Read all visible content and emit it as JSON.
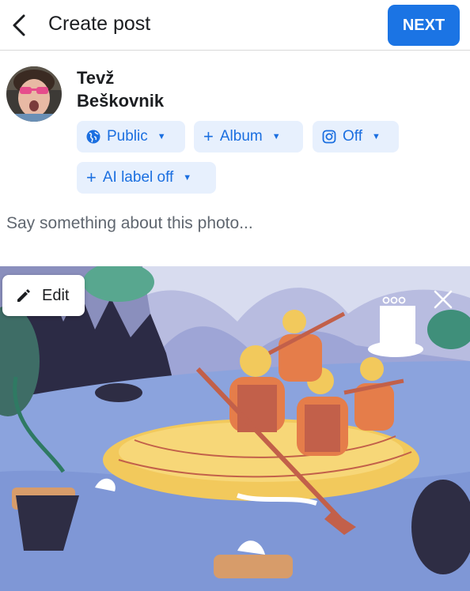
{
  "header": {
    "back_icon": "chevron-left-icon",
    "title": "Create post",
    "next_label": "NEXT",
    "accent": "#1b74e4"
  },
  "user": {
    "first_name": "Tevž",
    "last_name": "Beškovnik"
  },
  "audience": {
    "public_label": "Public",
    "album_label": "Album",
    "instagram_label": "Off",
    "ai_label": "AI label off"
  },
  "composer": {
    "placeholder": "Say something about this photo..."
  },
  "photo": {
    "edit_label": "Edit",
    "more_icon": "more-dots-icon",
    "close_icon": "close-icon"
  }
}
